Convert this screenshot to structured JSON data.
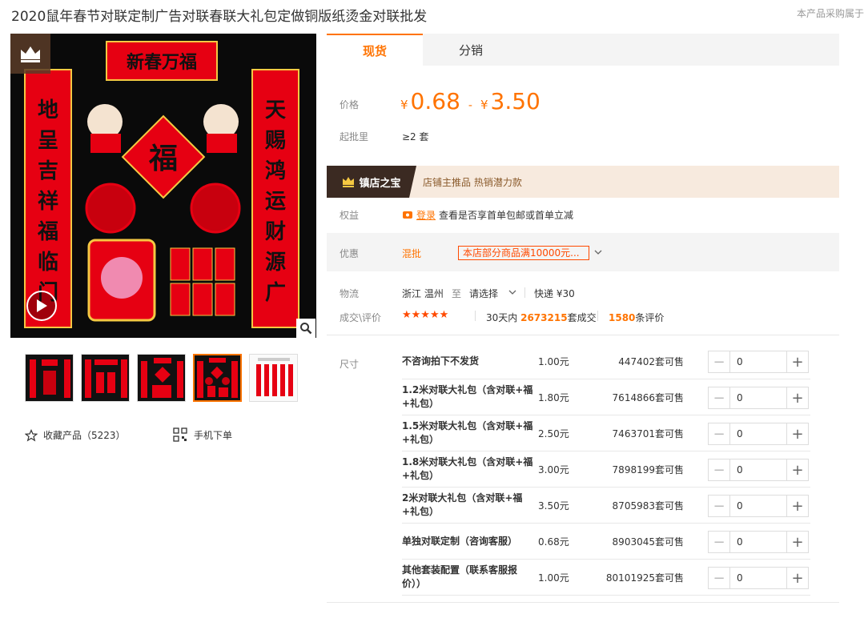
{
  "title": "2020鼠年春节对联定制广告对联春联大礼包定做铜版纸烫金对联批发",
  "title_note": "本产品采购属于",
  "tabs": [
    "现货",
    "分销"
  ],
  "price": {
    "label": "价格",
    "currency": "¥",
    "min": "0.68",
    "max": "3.50",
    "dash": "-"
  },
  "moq": {
    "label": "起批里",
    "value": "≥2 套"
  },
  "treasure": {
    "tag": "镇店之宝",
    "text": "店铺主推品  热销潜力款"
  },
  "rights": {
    "label": "权益",
    "login": "登录",
    "text": "查看是否享首单包邮或首单立减"
  },
  "promo": {
    "label": "优惠",
    "mix": "混批",
    "tag": "本店部分商品满10000元..."
  },
  "logistics": {
    "label": "物流",
    "origin": "浙江 温州",
    "to": "至",
    "dest": "请选择",
    "express": "快递 ¥30"
  },
  "deal": {
    "label": "成交\\评价",
    "stars": "★★★★★",
    "days_prefix": "30天内",
    "count": "2673215",
    "count_suffix": "套成交",
    "reviews": "1580",
    "reviews_suffix": "条评价"
  },
  "sku_label": "尺寸",
  "skus": [
    {
      "name": "不咨询拍下不发货",
      "price": "1.00元",
      "stock": "447402套可售",
      "qty": "0"
    },
    {
      "name": "1.2米对联大礼包（含对联+福+礼包）",
      "price": "1.80元",
      "stock": "7614866套可售",
      "qty": "0"
    },
    {
      "name": "1.5米对联大礼包（含对联+福+礼包）",
      "price": "2.50元",
      "stock": "7463701套可售",
      "qty": "0"
    },
    {
      "name": "1.8米对联大礼包（含对联+福+礼包）",
      "price": "3.00元",
      "stock": "7898199套可售",
      "qty": "0"
    },
    {
      "name": "2米对联大礼包（含对联+福+礼包）",
      "price": "3.50元",
      "stock": "8705983套可售",
      "qty": "0"
    },
    {
      "name": "单独对联定制（咨询客服）",
      "price": "0.68元",
      "stock": "8903045套可售",
      "qty": "0"
    },
    {
      "name": "其他套装配置（联系客服报价））",
      "price": "1.00元",
      "stock": "80101925套可售",
      "qty": "0"
    }
  ],
  "image": {
    "banner": "新春万福",
    "left_couplet": "地呈吉祥福临门",
    "right_couplet": "天赐鸿运财源广",
    "fu": "福"
  },
  "favorite": "收藏产品（5223）",
  "mobile_order": "手机下单",
  "colors": {
    "accent": "#ff7300",
    "red": "#e60012",
    "gold": "#f5c842"
  }
}
